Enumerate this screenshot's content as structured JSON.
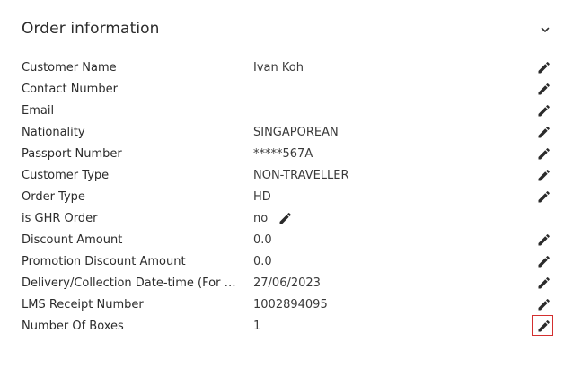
{
  "section": {
    "title": "Order information",
    "collapse_icon": "chevron-down-icon"
  },
  "rows": [
    {
      "label": "Customer Name",
      "value": "Ivan Koh"
    },
    {
      "label": "Contact Number",
      "value": ""
    },
    {
      "label": "Email",
      "value": ""
    },
    {
      "label": "Nationality",
      "value": "SINGAPOREAN"
    },
    {
      "label": "Passport Number",
      "value": "*****567A"
    },
    {
      "label": "Customer Type",
      "value": "NON-TRAVELLER"
    },
    {
      "label": "Order Type",
      "value": "HD"
    },
    {
      "label": "is GHR Order",
      "value": "no"
    },
    {
      "label": "Discount Amount",
      "value": "0.0"
    },
    {
      "label": "Promotion Discount Amount",
      "value": "0.0"
    },
    {
      "label": "Delivery/Collection Date-time (For D...",
      "value": "27/06/2023"
    },
    {
      "label": "LMS Receipt Number",
      "value": "1002894095"
    },
    {
      "label": "Number Of Boxes",
      "value": "1"
    }
  ],
  "edit_icon": "pencil-icon",
  "colors": {
    "text": "#2b2b2b",
    "highlight_border": "#d32f2f"
  }
}
